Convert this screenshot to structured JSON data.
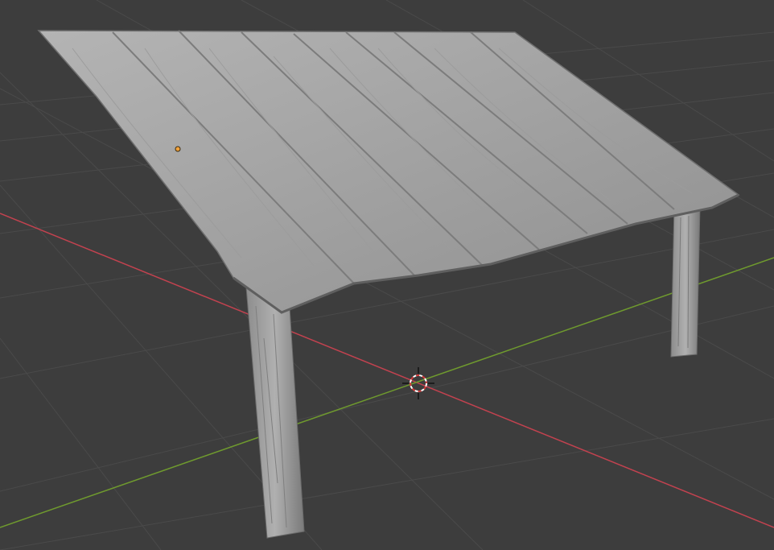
{
  "viewport": {
    "background": "#3d3d3d",
    "grid_color": "#4a4a4a",
    "x_axis_color": "#c2424f",
    "y_axis_color": "#6f9a2e",
    "model_color": "#a8a8a8"
  },
  "cursor": {
    "icon": "3d-cursor-icon"
  },
  "selection": {
    "icon": "origin-dot-icon",
    "color": "#f2a23a"
  }
}
